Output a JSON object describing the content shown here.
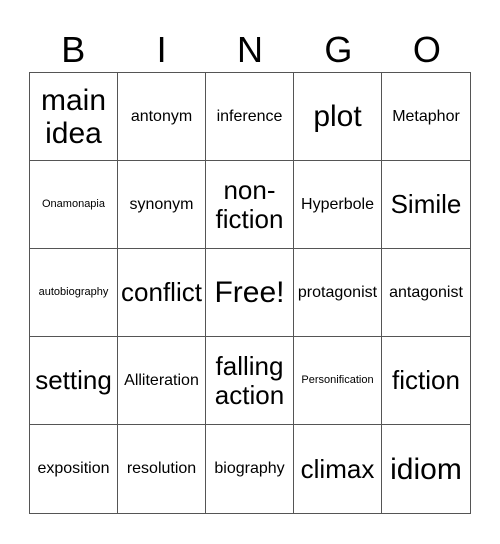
{
  "header": [
    "B",
    "I",
    "N",
    "G",
    "O"
  ],
  "cells": [
    {
      "text": "main idea",
      "size": "xl"
    },
    {
      "text": "antonym",
      "size": "md"
    },
    {
      "text": "inference",
      "size": "md"
    },
    {
      "text": "plot",
      "size": "xl"
    },
    {
      "text": "Metaphor",
      "size": "md"
    },
    {
      "text": "Onamonapia",
      "size": "xs"
    },
    {
      "text": "synonym",
      "size": "md"
    },
    {
      "text": "non-fiction",
      "size": "lg"
    },
    {
      "text": "Hyperbole",
      "size": "md"
    },
    {
      "text": "Simile",
      "size": "lg"
    },
    {
      "text": "autobiography",
      "size": "xs"
    },
    {
      "text": "conflict",
      "size": "lg"
    },
    {
      "text": "Free!",
      "size": "xl"
    },
    {
      "text": "protagonist",
      "size": "md"
    },
    {
      "text": "antagonist",
      "size": "md"
    },
    {
      "text": "setting",
      "size": "lg"
    },
    {
      "text": "Alliteration",
      "size": "md"
    },
    {
      "text": "falling action",
      "size": "lg"
    },
    {
      "text": "Personification",
      "size": "xs"
    },
    {
      "text": "fiction",
      "size": "lg"
    },
    {
      "text": "exposition",
      "size": "md"
    },
    {
      "text": "resolution",
      "size": "md"
    },
    {
      "text": "biography",
      "size": "md"
    },
    {
      "text": "climax",
      "size": "lg"
    },
    {
      "text": "idiom",
      "size": "xl"
    }
  ]
}
